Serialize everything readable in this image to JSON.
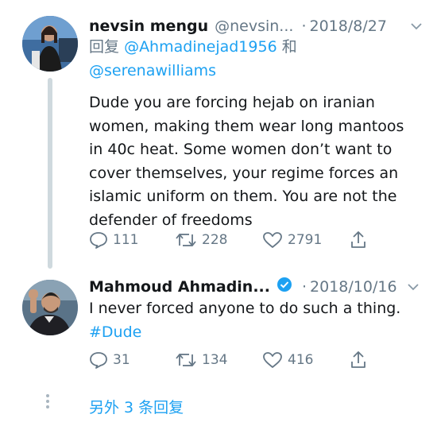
{
  "tweets": [
    {
      "name": "nevsin mengu",
      "handle": "@nevsin...",
      "date": "2018/8/27",
      "reply_prefix": "回复",
      "reply_to_1": "@Ahmadinejad1956",
      "reply_joiner": "和",
      "reply_to_2": "@serenawilliams",
      "text_lines": [
        "Dude you are forcing hejab on iranian",
        "women, making them wear long mantoos",
        "in 40c heat. Some women don’t want to",
        "cover themselves, your regime forces an",
        "islamic uniform on them. You are not the",
        "defender of freedoms"
      ],
      "replies": "111",
      "retweets": "228",
      "likes": "2791",
      "avatar": "avatar-photo-woman-presenter"
    },
    {
      "name": "Mahmoud Ahmadin...",
      "date": "2018/10/16",
      "verified": true,
      "text_line_1": "I never forced anyone to do such a thing.",
      "hashtag": "#Dude",
      "replies": "31",
      "retweets": "134",
      "likes": "416",
      "avatar": "avatar-photo-man-waving"
    }
  ],
  "more_replies": "另外 3 条回复",
  "colors": {
    "link": "#1da1f2",
    "muted": "#657786",
    "text": "#14171a",
    "thread_line": "#cfd9de"
  },
  "icons": [
    "reply-icon",
    "retweet-icon",
    "like-icon",
    "share-icon",
    "verified-icon",
    "chevron-down-icon"
  ]
}
